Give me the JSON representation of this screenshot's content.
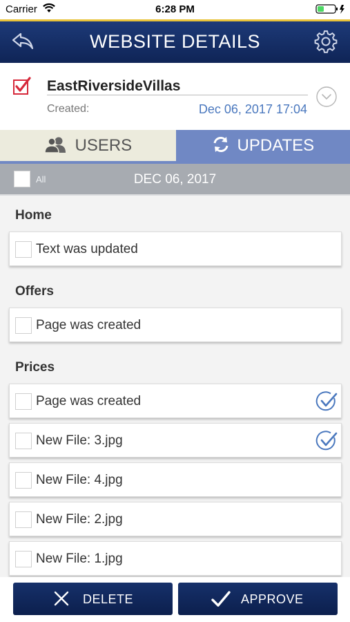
{
  "status_bar": {
    "carrier": "Carrier",
    "time": "6:28 PM"
  },
  "header": {
    "title": "WEBSITE DETAILS",
    "back_icon": "back-arrow-icon",
    "settings_icon": "gear-icon"
  },
  "site": {
    "name": "EastRiversideVillas",
    "created_label": "Created:",
    "created_date": "Dec 06, 2017 17:04",
    "selected": true
  },
  "tabs": [
    {
      "label": "USERS",
      "icon": "users-icon",
      "active": false
    },
    {
      "label": "UPDATES",
      "icon": "refresh-icon",
      "active": true
    }
  ],
  "date_strip": {
    "all_label": "All",
    "date": "DEC 06, 2017"
  },
  "sections": [
    {
      "title": "Home",
      "items": [
        {
          "label": "Text was updated",
          "approved": false
        }
      ]
    },
    {
      "title": "Offers",
      "items": [
        {
          "label": "Page was created",
          "approved": false
        }
      ]
    },
    {
      "title": "Prices",
      "items": [
        {
          "label": "Page was created",
          "approved": true
        },
        {
          "label": "New File: 3.jpg",
          "approved": true
        },
        {
          "label": "New File: 4.jpg",
          "approved": false
        },
        {
          "label": "New File: 2.jpg",
          "approved": false
        },
        {
          "label": "New File: 1.jpg",
          "approved": false
        }
      ]
    }
  ],
  "actions": {
    "delete_label": "DELETE",
    "approve_label": "APPROVE"
  },
  "colors": {
    "header_bg": "#1d3a78",
    "accent_blue": "#4a78be",
    "tab_active_bg": "#7088c4",
    "checkbox_red": "#d6283a"
  }
}
